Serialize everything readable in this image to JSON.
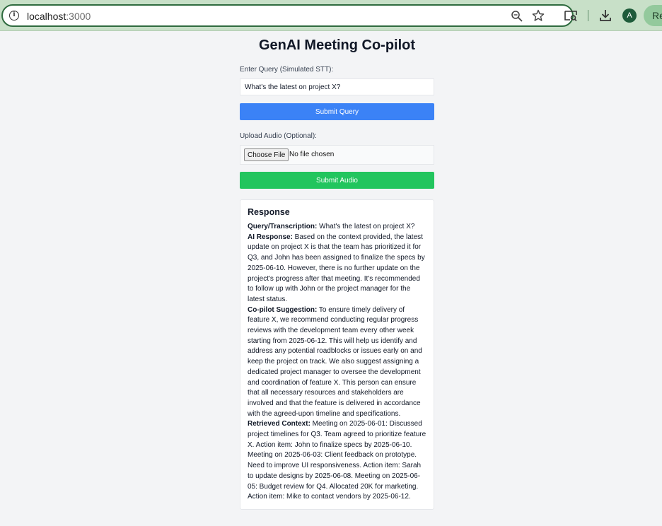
{
  "browser": {
    "url_host": "localhost",
    "url_port": ":3000",
    "avatar_letter": "A",
    "relaunch_label": "Re"
  },
  "app": {
    "title": "GenAI Meeting Co-pilot",
    "query_label": "Enter Query (Simulated STT):",
    "query_value": "What's the latest on project X?",
    "submit_query_label": "Submit Query",
    "audio_label": "Upload Audio (Optional):",
    "choose_file_label": "Choose File",
    "no_file_text": "No file chosen",
    "submit_audio_label": "Submit Audio"
  },
  "response": {
    "heading": "Response",
    "transcription_label": "Query/Transcription:",
    "transcription_text": " What's the latest on project X?",
    "ai_label": "AI Response:",
    "ai_text": " Based on the context provided, the latest update on project X is that the team has prioritized it for Q3, and John has been assigned to finalize the specs by 2025-06-10. However, there is no further update on the project's progress after that meeting. It's recommended to follow up with John or the project manager for the latest status.",
    "suggestion_label": "Co-pilot Suggestion:",
    "suggestion_text": " To ensure timely delivery of feature X, we recommend conducting regular progress reviews with the development team every other week starting from 2025-06-12. This will help us identify and address any potential roadblocks or issues early on and keep the project on track. We also suggest assigning a dedicated project manager to oversee the development and coordination of feature X. This person can ensure that all necessary resources and stakeholders are involved and that the feature is delivered in accordance with the agreed-upon timeline and specifications.",
    "context_label": "Retrieved Context:",
    "context_text": " Meeting on 2025-06-01: Discussed project timelines for Q3. Team agreed to prioritize feature X. Action item: John to finalize specs by 2025-06-10. Meeting on 2025-06-03: Client feedback on prototype. Need to improve UI responsiveness. Action item: Sarah to update designs by 2025-06-08. Meeting on 2025-06-05: Budget review for Q4. Allocated 20K for marketing. Action item: Mike to contact vendors by 2025-06-12."
  },
  "colors": {
    "submit_query": "#3b82f6",
    "submit_audio": "#22c55e",
    "chrome": "#c8e0c8"
  },
  "icons": [
    "info-icon",
    "zoom-icon",
    "star-icon",
    "tab-search-icon",
    "download-icon"
  ]
}
